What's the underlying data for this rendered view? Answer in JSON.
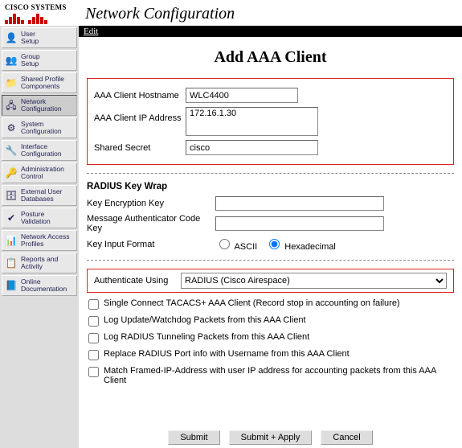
{
  "logo_text": "CISCO SYSTEMS",
  "page_heading": "Network Configuration",
  "menubar": {
    "edit": "Edit"
  },
  "sidebar": {
    "items": [
      {
        "label": "User\nSetup",
        "icon": "👤",
        "active": false
      },
      {
        "label": "Group\nSetup",
        "icon": "👥",
        "active": false
      },
      {
        "label": "Shared Profile\nComponents",
        "icon": "📁",
        "active": false
      },
      {
        "label": "Network\nConfiguration",
        "icon": "🖧",
        "active": true
      },
      {
        "label": "System\nConfiguration",
        "icon": "⚙",
        "active": false
      },
      {
        "label": "Interface\nConfiguration",
        "icon": "🔧",
        "active": false
      },
      {
        "label": "Administration\nControl",
        "icon": "🔑",
        "active": false
      },
      {
        "label": "External User\nDatabases",
        "icon": "🗄",
        "active": false
      },
      {
        "label": "Posture\nValidation",
        "icon": "✔",
        "active": false
      },
      {
        "label": "Network Access\nProfiles",
        "icon": "📊",
        "active": false
      },
      {
        "label": "Reports and\nActivity",
        "icon": "📋",
        "active": false
      },
      {
        "label": "Online\nDocumentation",
        "icon": "📘",
        "active": false
      }
    ]
  },
  "form": {
    "title": "Add AAA Client",
    "hostname_label": "AAA Client Hostname",
    "hostname_value": "WLC4400",
    "ip_label": "AAA Client IP Address",
    "ip_value": "172.16.1.30",
    "secret_label": "Shared Secret",
    "secret_value": "cisco",
    "keywrap": {
      "heading": "RADIUS Key Wrap",
      "kek_label": "Key Encryption Key",
      "kek_value": "",
      "mack_label": "Message Authenticator Code Key",
      "mack_value": "",
      "format_label": "Key Input Format",
      "ascii_label": "ASCII",
      "hex_label": "Hexadecimal",
      "format_selected": "Hexadecimal"
    },
    "auth_using_label": "Authenticate Using",
    "auth_using_value": "RADIUS (Cisco Airespace)",
    "checkboxes": [
      "Single Connect TACACS+ AAA Client (Record stop in accounting on failure)",
      "Log Update/Watchdog Packets from this AAA Client",
      "Log RADIUS Tunneling Packets from this AAA Client",
      "Replace RADIUS Port info with Username from this AAA Client",
      "Match Framed-IP-Address with user IP address for accounting packets from this AAA Client"
    ]
  },
  "buttons": {
    "submit": "Submit",
    "submit_apply": "Submit + Apply",
    "cancel": "Cancel"
  }
}
